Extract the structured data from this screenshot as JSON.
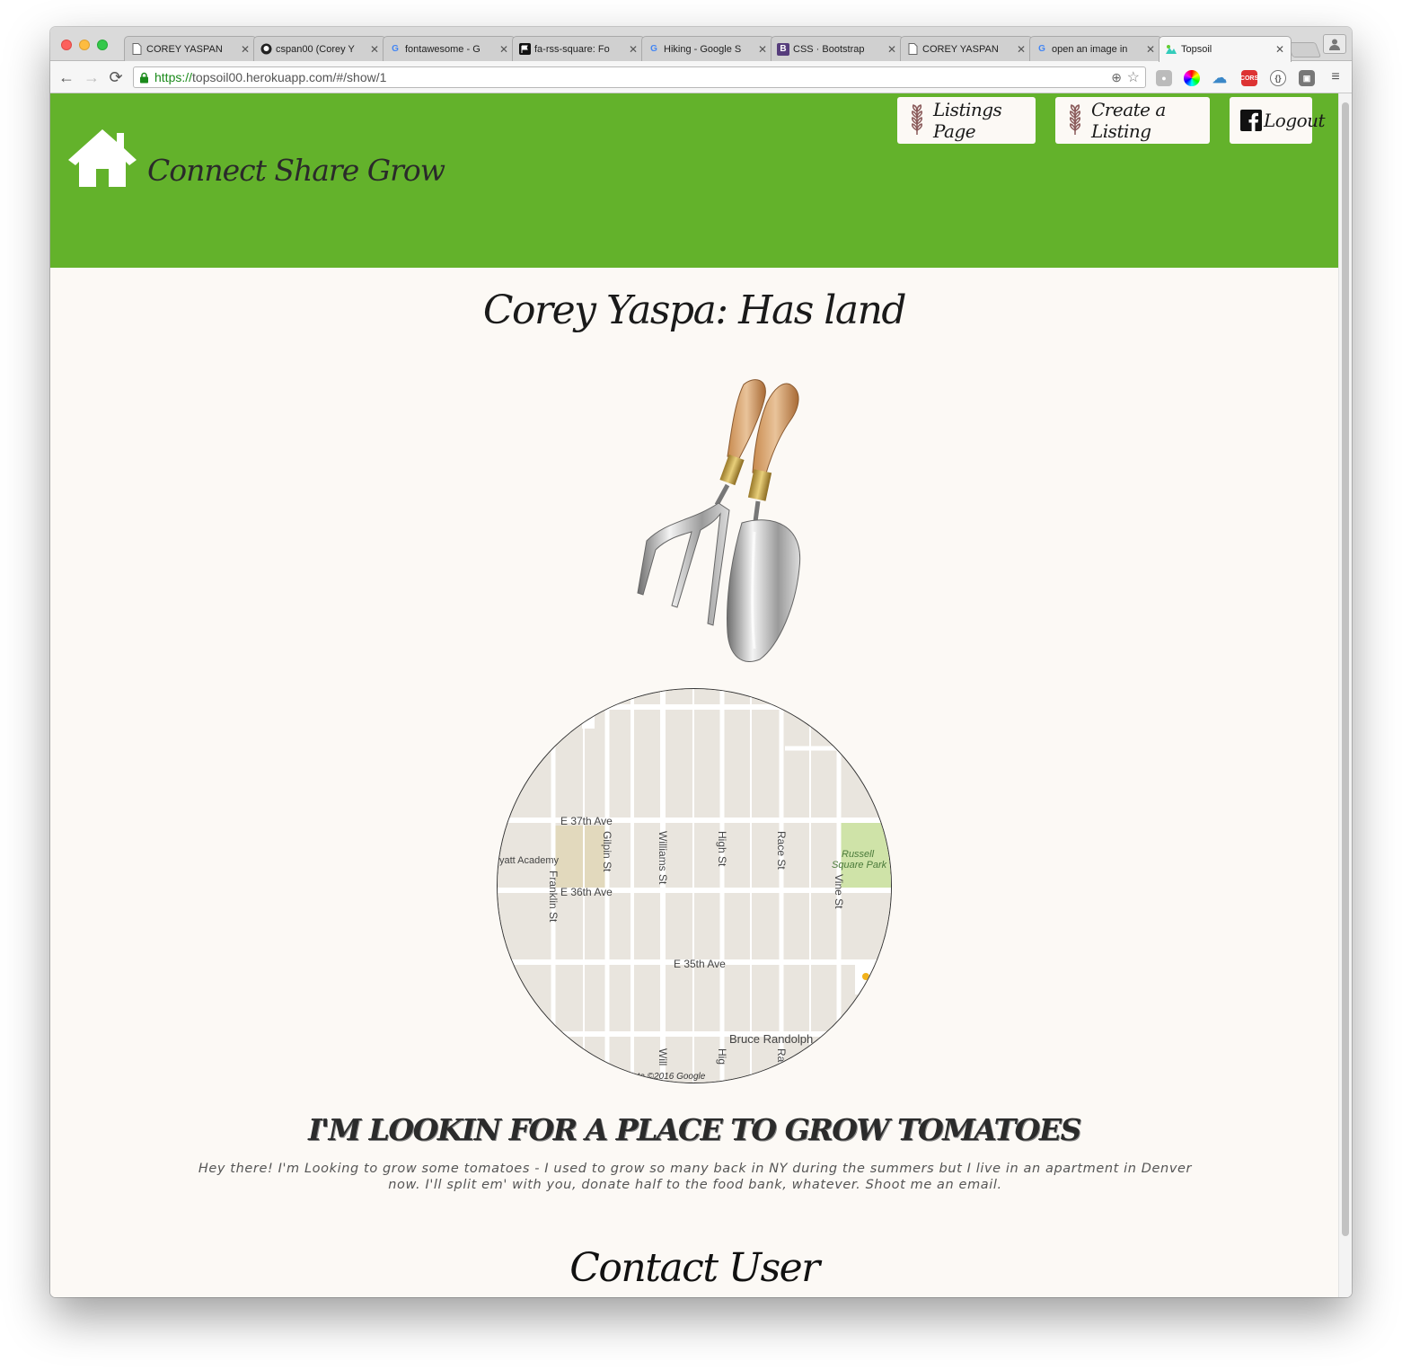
{
  "browser": {
    "tabs": [
      {
        "title": "COREY YASPAN",
        "favicon": "page-icon"
      },
      {
        "title": "cspan00 (Corey Y",
        "favicon": "github-icon"
      },
      {
        "title": "fontawesome - G",
        "favicon": "google-icon"
      },
      {
        "title": "fa-rss-square: Fo",
        "favicon": "flag-icon"
      },
      {
        "title": "Hiking - Google S",
        "favicon": "google-icon"
      },
      {
        "title": "CSS · Bootstrap",
        "favicon": "bootstrap-icon"
      },
      {
        "title": "COREY YASPAN",
        "favicon": "page-icon"
      },
      {
        "title": "open an image in",
        "favicon": "google-icon"
      },
      {
        "title": "Topsoil",
        "favicon": "topsoil-icon"
      }
    ],
    "url_secure": "https://",
    "url_rest": "topsoil00.herokuapp.com/#/show/1"
  },
  "site": {
    "brand": "Connect Share Grow",
    "nav": {
      "listings": "Listings Page",
      "create": "Create a Listing",
      "logout": "Logout"
    }
  },
  "listing": {
    "title": "Corey Yaspa: Has land",
    "heading": "I'M LOOKIN FOR A PLACE TO GROW TOMATOES",
    "description": "Hey there! I'm Looking to grow some tomatoes - I used to grow so many back in NY during the summers but I live in an apartment in Denver now. I'll split em' with you, donate half to the food bank, whatever. Shoot me an email.",
    "contact": "Contact User"
  },
  "map": {
    "labels": {
      "e37": "E 37th Ave",
      "e36": "E 36th Ave",
      "e35": "E 35th Ave",
      "bruce": "Bruce Randolph",
      "gilpin": "Gilpin St",
      "williams": "Williams St",
      "high": "High St",
      "race": "Race St",
      "vine": "Vine St",
      "franklin": "Franklin St",
      "academy": "yatt Academy",
      "park1": "Russell",
      "park2": "Square Park",
      "williams2": "Will",
      "high2": "Hig",
      "race2": "Ra",
      "copyright": "ata ©2016 Google"
    }
  },
  "colors": {
    "header_green": "#63b22b",
    "page_bg": "#fcf9f5"
  }
}
